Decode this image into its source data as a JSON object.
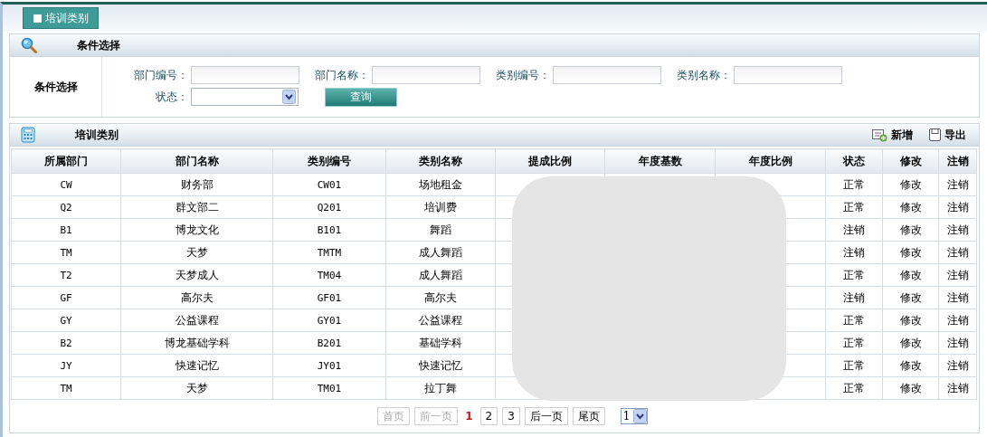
{
  "tab": {
    "label": "培训类别",
    "selected": true
  },
  "filter_panel": {
    "title": "条件选择",
    "side_label": "条件选择",
    "fields": [
      {
        "label": "部门编号：",
        "kind": "text"
      },
      {
        "label": "部门名称：",
        "kind": "text"
      },
      {
        "label": "类别编号：",
        "kind": "text"
      },
      {
        "label": "类别名称：",
        "kind": "text"
      },
      {
        "label": "状态：",
        "kind": "select"
      }
    ],
    "search_button": "查询"
  },
  "list_panel": {
    "title": "培训类别",
    "actions": [
      {
        "label": "新增",
        "kind": "add"
      },
      {
        "label": "导出",
        "kind": "export"
      }
    ]
  },
  "table": {
    "columns": [
      "所属部门",
      "部门名称",
      "类别编号",
      "类别名称",
      "提成比例",
      "年度基数",
      "年度比例",
      "状态",
      "修改",
      "注销"
    ],
    "rows": [
      {
        "dept_code": "CW",
        "dept_name": "财务部",
        "category_code": "CW01",
        "category_name": "场地租金",
        "status": "正常",
        "edit": "修改",
        "cancel": "注销"
      },
      {
        "dept_code": "Q2",
        "dept_name": "群文部二",
        "category_code": "Q201",
        "category_name": "培训费",
        "status": "正常",
        "edit": "修改",
        "cancel": "注销"
      },
      {
        "dept_code": "B1",
        "dept_name": "博龙文化",
        "category_code": "B101",
        "category_name": "舞蹈",
        "status": "注销",
        "edit": "修改",
        "cancel": "注销"
      },
      {
        "dept_code": "TM",
        "dept_name": "天梦",
        "category_code": "TMTM",
        "category_name": "成人舞蹈",
        "status": "注销",
        "edit": "修改",
        "cancel": "注销"
      },
      {
        "dept_code": "T2",
        "dept_name": "天梦成人",
        "category_code": "TM04",
        "category_name": "成人舞蹈",
        "status": "正常",
        "edit": "修改",
        "cancel": "注销"
      },
      {
        "dept_code": "GF",
        "dept_name": "高尔夫",
        "category_code": "GF01",
        "category_name": "高尔夫",
        "status": "注销",
        "edit": "修改",
        "cancel": "注销"
      },
      {
        "dept_code": "GY",
        "dept_name": "公益课程",
        "category_code": "GY01",
        "category_name": "公益课程",
        "status": "正常",
        "edit": "修改",
        "cancel": "注销"
      },
      {
        "dept_code": "B2",
        "dept_name": "博龙基础学科",
        "category_code": "B201",
        "category_name": "基础学科",
        "status": "正常",
        "edit": "修改",
        "cancel": "注销"
      },
      {
        "dept_code": "JY",
        "dept_name": "快速记忆",
        "category_code": "JY01",
        "category_name": "快速记忆",
        "status": "正常",
        "edit": "修改",
        "cancel": "注销"
      },
      {
        "dept_code": "TM",
        "dept_name": "天梦",
        "category_code": "TM01",
        "category_name": "拉丁舞",
        "status": "正常",
        "edit": "修改",
        "cancel": "注销"
      }
    ]
  },
  "pagination": {
    "before": [
      {
        "label": "首页",
        "disabled": true
      },
      {
        "label": "前一页",
        "disabled": true
      }
    ],
    "pages": [
      {
        "label": "1",
        "selected": true
      },
      {
        "label": "2",
        "selected": false
      },
      {
        "label": "3",
        "selected": false
      }
    ],
    "after": [
      {
        "label": "后一页",
        "disabled": false
      },
      {
        "label": "尾页",
        "disabled": false
      }
    ],
    "page_select": "1"
  }
}
